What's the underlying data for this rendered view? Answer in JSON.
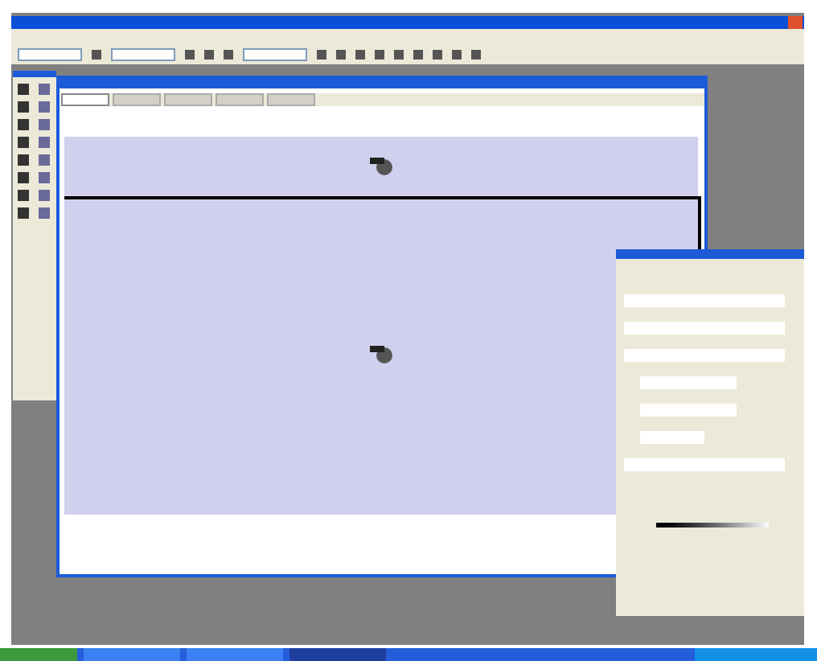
{
  "toolbar": [
    {
      "kind": "field"
    },
    {
      "kind": "icon"
    },
    {
      "kind": "field"
    },
    {
      "kind": "icon"
    },
    {
      "kind": "icon"
    },
    {
      "kind": "icon"
    },
    {
      "kind": "field"
    },
    {
      "kind": "icon"
    },
    {
      "kind": "icon"
    },
    {
      "kind": "icon"
    },
    {
      "kind": "icon"
    },
    {
      "kind": "icon"
    },
    {
      "kind": "icon"
    },
    {
      "kind": "icon"
    },
    {
      "kind": "icon"
    },
    {
      "kind": "icon"
    }
  ],
  "tools": [
    {
      "kind": "a"
    },
    {
      "kind": "b"
    },
    {
      "kind": "a"
    },
    {
      "kind": "b"
    },
    {
      "kind": "a"
    },
    {
      "kind": "b"
    },
    {
      "kind": "a"
    },
    {
      "kind": "b"
    },
    {
      "kind": "a"
    },
    {
      "kind": "b"
    },
    {
      "kind": "a"
    },
    {
      "kind": "b"
    },
    {
      "kind": "a"
    },
    {
      "kind": "b"
    },
    {
      "kind": "a"
    },
    {
      "kind": "b"
    }
  ],
  "document_tabs": [
    {
      "selected": true
    },
    {
      "selected": false
    },
    {
      "selected": false
    },
    {
      "selected": false
    },
    {
      "selected": false
    }
  ],
  "panel_fields": [
    {
      "kind": "wide"
    },
    {
      "kind": "wide"
    },
    {
      "kind": "wide"
    },
    {
      "kind": "pair"
    },
    {
      "kind": "pair"
    },
    {
      "kind": "short"
    },
    {
      "kind": "wide"
    }
  ],
  "taskbar": [
    {
      "selected": false
    },
    {
      "selected": false
    },
    {
      "selected": true
    }
  ]
}
